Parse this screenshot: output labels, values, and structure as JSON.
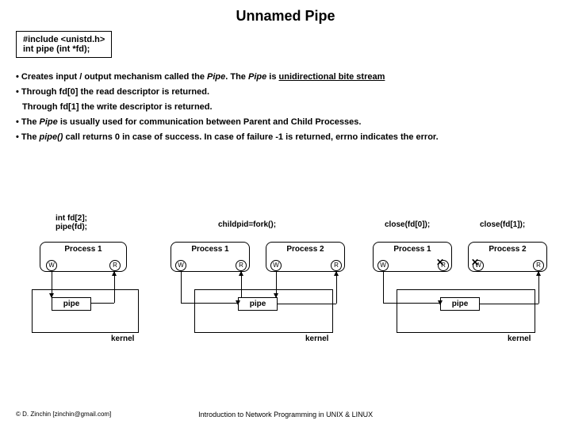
{
  "title": "Unnamed Pipe",
  "code": {
    "line1": "#include <unistd.h>",
    "line2": "int pipe (int  *fd);"
  },
  "bullets": {
    "b1a": "• Creates input / output mechanism called the ",
    "b1b": "Pipe",
    "b1c": ". The ",
    "b1d": "Pipe",
    "b1e": " is ",
    "b1f": "unidirectional bite stream",
    "b2": "• Through fd[0] the read descriptor is returned.",
    "b2s": "Through fd[1] the write descriptor is returned.",
    "b3a": "• The ",
    "b3b": "Pipe",
    "b3c": "  is usually used for communication between Parent and Child Processes.",
    "b4a": "• The ",
    "b4b": "pipe()",
    "b4c": "  call returns 0 in case of success. In case of failure -1 is returned, errno indicates the error."
  },
  "diag": {
    "d1": {
      "code1": "int fd[2];",
      "code2": "pipe(fd);",
      "proc": "Process 1",
      "pipe": "pipe",
      "kernel": "kernel"
    },
    "d2": {
      "code": "childpid=fork();",
      "p1": "Process 1",
      "p2": "Process 2",
      "pipe": "pipe",
      "kernel": "kernel"
    },
    "d3": {
      "c1": "close(fd[0]);",
      "c2": "close(fd[1]);",
      "p1": "Process 1",
      "p2": "Process 2",
      "pipe": "pipe",
      "kernel": "kernel"
    }
  },
  "labels": {
    "W": "W",
    "R": "R"
  },
  "footer": {
    "left": "© D. Zinchin [zinchin@gmail.com]",
    "center": "Introduction to Network Programming in UNIX & LINUX"
  }
}
